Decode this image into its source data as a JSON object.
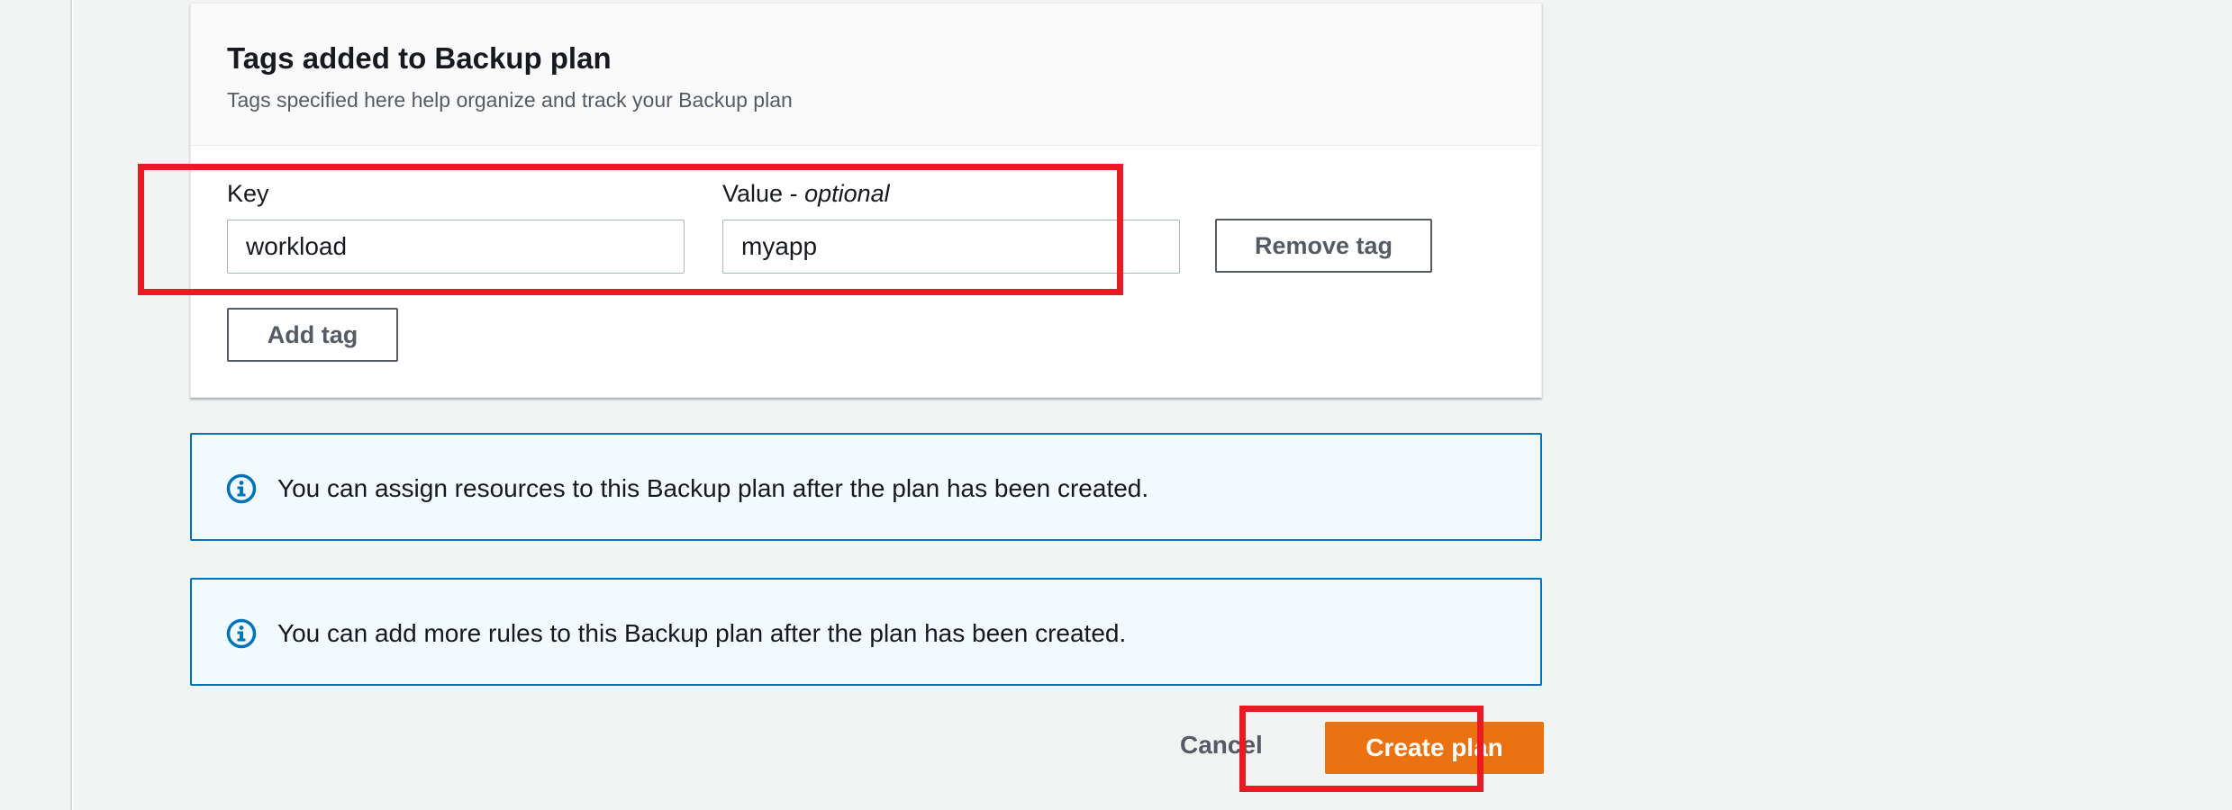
{
  "tags_section": {
    "title": "Tags added to Backup plan",
    "description": "Tags specified here help organize and track your Backup plan",
    "key_label": "Key",
    "value_label": "Value",
    "value_label_separator": " - ",
    "value_label_optional": "optional",
    "tag": {
      "key": "workload",
      "value": "myapp"
    },
    "remove_tag_label": "Remove tag",
    "add_tag_label": "Add tag"
  },
  "alerts": [
    {
      "icon": "info-icon",
      "text": "You can assign resources to this Backup plan after the plan has been created."
    },
    {
      "icon": "info-icon",
      "text": "You can add more rules to this Backup plan after the plan has been created."
    }
  ],
  "footer": {
    "cancel_label": "Cancel",
    "create_label": "Create plan"
  },
  "colors": {
    "primary_button": "#ec7211",
    "highlight": "#e81b23",
    "info_border": "#0073bb",
    "info_background": "#f1faff"
  }
}
